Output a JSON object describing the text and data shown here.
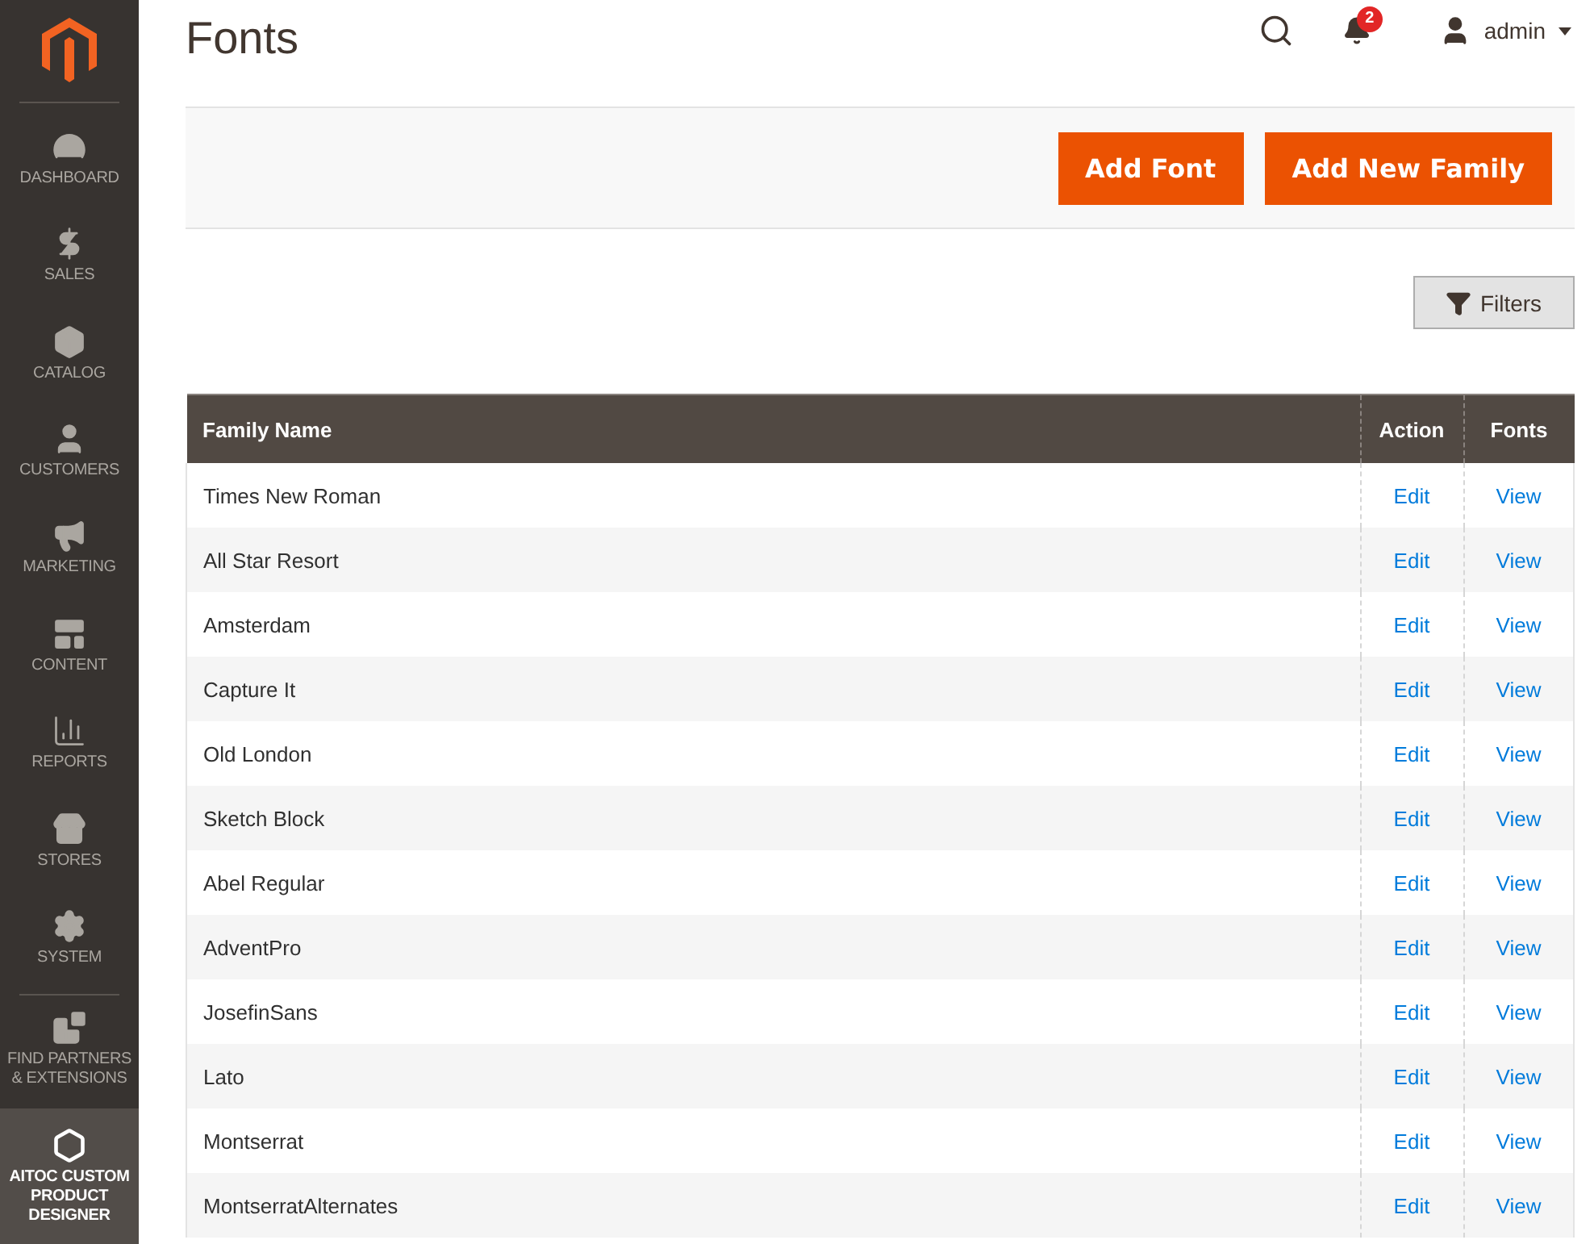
{
  "sidebar": {
    "items": [
      {
        "label": "DASHBOARD",
        "selected": false
      },
      {
        "label": "SALES",
        "selected": false
      },
      {
        "label": "CATALOG",
        "selected": false
      },
      {
        "label": "CUSTOMERS",
        "selected": false
      },
      {
        "label": "MARKETING",
        "selected": false
      },
      {
        "label": "CONTENT",
        "selected": false
      },
      {
        "label": "REPORTS",
        "selected": false
      },
      {
        "label": "STORES",
        "selected": false
      },
      {
        "label": "SYSTEM",
        "selected": false
      },
      {
        "label": "FIND PARTNERS & EXTENSIONS",
        "selected": false
      },
      {
        "label": "AITOC CUSTOM PRODUCT DESIGNER",
        "selected": true
      }
    ]
  },
  "header": {
    "title": "Fonts",
    "notification_count": "2",
    "user": "admin"
  },
  "actions": [
    "Add Font",
    "Add New Family"
  ],
  "filters_button": "Filters",
  "table": {
    "columns": [
      "Family Name",
      "Action",
      "Fonts"
    ],
    "rows": [
      {
        "family": "Times New Roman",
        "action": "Edit",
        "fonts": "View"
      },
      {
        "family": "All Star Resort",
        "action": "Edit",
        "fonts": "View"
      },
      {
        "family": "Amsterdam",
        "action": "Edit",
        "fonts": "View"
      },
      {
        "family": "Capture It",
        "action": "Edit",
        "fonts": "View"
      },
      {
        "family": "Old London",
        "action": "Edit",
        "fonts": "View"
      },
      {
        "family": "Sketch Block",
        "action": "Edit",
        "fonts": "View"
      },
      {
        "family": "Abel Regular",
        "action": "Edit",
        "fonts": "View"
      },
      {
        "family": "AdventPro",
        "action": "Edit",
        "fonts": "View"
      },
      {
        "family": "JosefinSans",
        "action": "Edit",
        "fonts": "View"
      },
      {
        "family": "Lato",
        "action": "Edit",
        "fonts": "View"
      },
      {
        "family": "Montserrat",
        "action": "Edit",
        "fonts": "View"
      },
      {
        "family": "MontserratAlternates",
        "action": "Edit",
        "fonts": "View"
      }
    ]
  }
}
